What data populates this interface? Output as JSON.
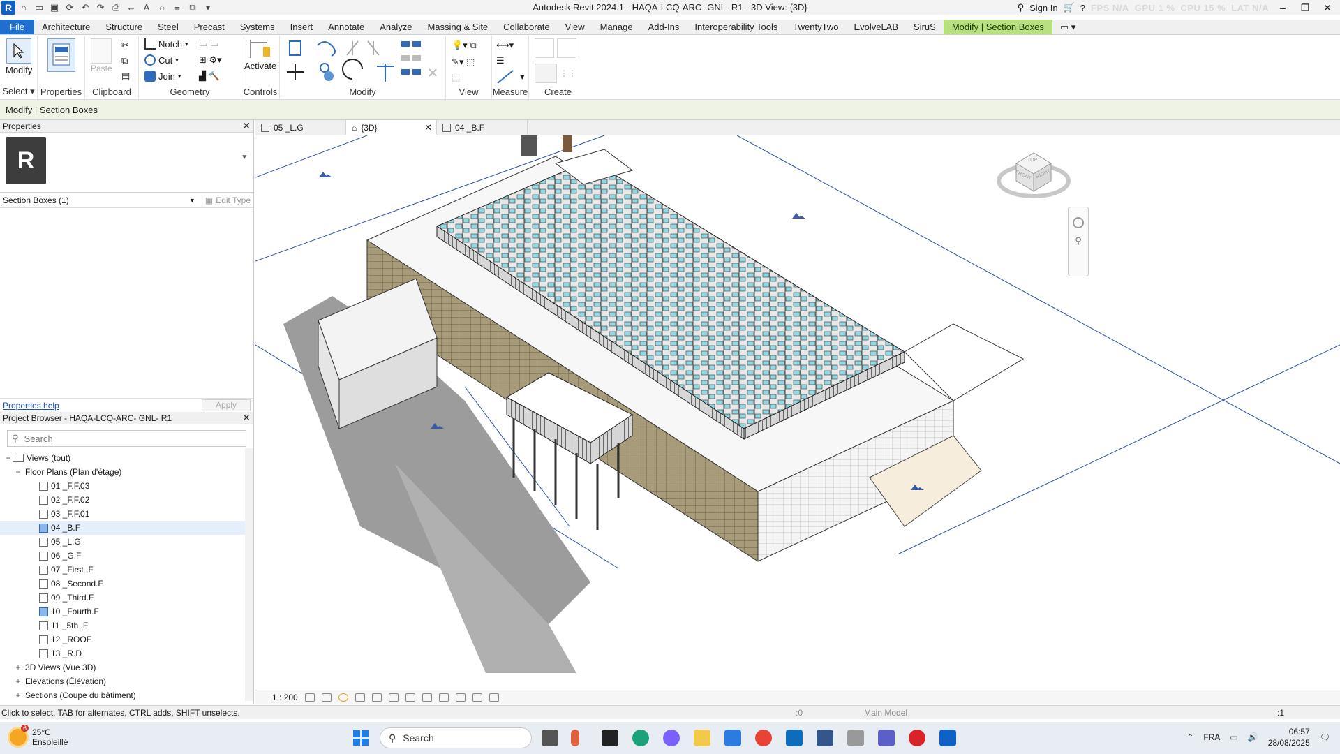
{
  "app": {
    "title": "Autodesk Revit 2024.1 - HAQA-LCQ-ARC- GNL- R1 - 3D View: {3D}",
    "sign_in": "Sign In",
    "perf": {
      "fps": "FPS N/A",
      "gpu": "GPU 1 %",
      "cpu": "CPU 15 %",
      "lat": "LAT N/A"
    }
  },
  "ribbon_tabs": [
    "File",
    "Architecture",
    "Structure",
    "Steel",
    "Precast",
    "Systems",
    "Insert",
    "Annotate",
    "Analyze",
    "Massing & Site",
    "Collaborate",
    "View",
    "Manage",
    "Add-Ins",
    "Interoperability Tools",
    "TwentyTwo",
    "EvolveLAB",
    "SiruS",
    "Modify | Section Boxes"
  ],
  "ribbon": {
    "select": {
      "tool": "Modify",
      "label": "Select"
    },
    "properties": {
      "tool": "Properties",
      "label": "Properties"
    },
    "clipboard": {
      "paste": "Paste",
      "label": "Clipboard"
    },
    "geometry": {
      "notch": "Notch",
      "cut": "Cut",
      "join": "Join",
      "label": "Geometry"
    },
    "controls": {
      "tool": "Activate",
      "label": "Controls"
    },
    "modify": {
      "label": "Modify"
    },
    "view": {
      "label": "View"
    },
    "measure": {
      "label": "Measure"
    },
    "create": {
      "label": "Create"
    }
  },
  "options_bar": {
    "text": "Modify | Section Boxes"
  },
  "properties_palette": {
    "title": "Properties",
    "instance": "Section Boxes (1)",
    "edit_type": "Edit Type",
    "help": "Properties help",
    "apply": "Apply"
  },
  "project_browser": {
    "title": "Project Browser - HAQA-LCQ-ARC- GNL- R1",
    "search_placeholder": "Search",
    "root": "Views (tout)",
    "floor_plans": "Floor Plans (Plan d'étage)",
    "plans": [
      "01 _F.F.03",
      "02 _F.F.02",
      "03 _F.F.01",
      "04 _B.F",
      "05 _L.G",
      "06 _G.F",
      "07 _First .F",
      "08 _Second.F",
      "09 _Third.F",
      "10 _Fourth.F",
      "11 _5th .F",
      "12 _ROOF",
      "13 _R.D"
    ],
    "views_3d": "3D Views (Vue 3D)",
    "elevations": "Elevations (Élévation)",
    "sections": "Sections (Coupe du bâtiment)"
  },
  "view_tabs": [
    "05 _L.G",
    "{3D}",
    "04 _B.F"
  ],
  "view_control": {
    "scale": "1 : 200"
  },
  "viewcube": {
    "top": "TOP",
    "front": "FRONT",
    "right": "RIGHT"
  },
  "status": {
    "text": "Click to select, TAB for alternates, CTRL adds, SHIFT unselects.",
    "workset": ":0",
    "model": "Main Model",
    "filter": ":1"
  },
  "taskbar": {
    "weather_temp": "25°C",
    "weather_desc": "Ensoleillé",
    "weather_badge": "6",
    "search": "Search",
    "lang": "FRA",
    "time": "06:57",
    "date": "28/08/2025"
  },
  "colors": {
    "accent": "#1e6fcf",
    "context_tab": "#b8e07e",
    "glass": "#8fd8e4",
    "facade": "#a89b7a"
  }
}
